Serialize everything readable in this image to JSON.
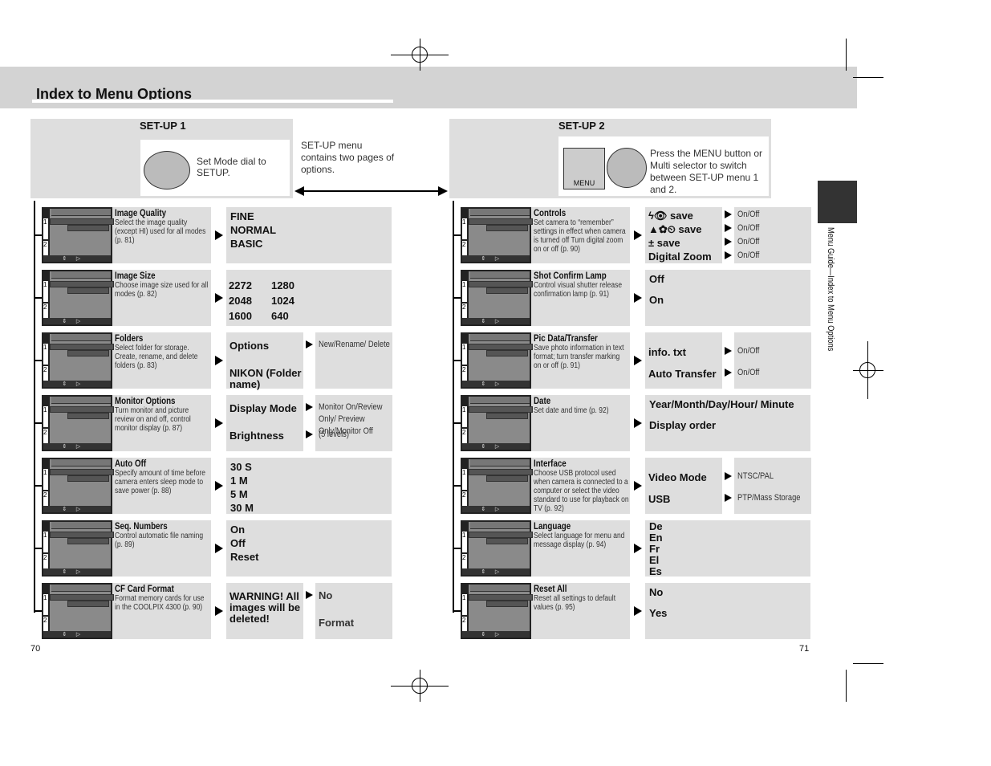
{
  "title": "Index to Menu Options",
  "setup1": {
    "heading": "SET-UP 1",
    "dial_text": "Set Mode dial to SETUP.",
    "note": "SET-UP menu contains two pages of options."
  },
  "setup2": {
    "heading": "SET-UP 2",
    "note": "Press the MENU button or Multi selector to switch between SET-UP menu 1 and 2.",
    "menu_button_label": "MENU"
  },
  "screen": {
    "menu_label": "MENU",
    "page1": "1",
    "page2": "2"
  },
  "left_rows": [
    {
      "name": "Image Quality",
      "desc": "Select the image quality (except HI) used for all modes (p. 81)",
      "options": [
        "FINE",
        "NORMAL",
        "BASIC"
      ]
    },
    {
      "name": "Image Size",
      "desc": "Choose image size used for all modes (p. 82)",
      "grid": [
        [
          "2272",
          "1280"
        ],
        [
          "2048",
          "1024"
        ],
        [
          "1600",
          "640"
        ]
      ]
    },
    {
      "name": "Folders",
      "desc": "Select folder for storage. Create, rename, and delete folders (p. 83)",
      "split": [
        {
          "label": "Options",
          "sub": "New/Rename/ Delete",
          "arrow": true
        },
        {
          "label": "NIKON (Folder name)",
          "sub": "",
          "arrow": false
        }
      ]
    },
    {
      "name": "Monitor Options",
      "desc": "Turn monitor and picture review on and off, control monitor display (p. 87)",
      "split": [
        {
          "label": "Display Mode",
          "sub": "Monitor On/Review Only/ Preview Only/Monitor Off",
          "arrow": true
        },
        {
          "label": "Brightness",
          "sub": "(5 levels)",
          "arrow": true
        }
      ]
    },
    {
      "name": "Auto Off",
      "desc": "Specify amount of time before camera enters sleep mode to save power (p. 88)",
      "options": [
        "30 S",
        "1 M",
        "5 M",
        "30 M"
      ]
    },
    {
      "name": "Seq. Numbers",
      "desc": "Control automatic file naming (p. 89)",
      "options": [
        "On",
        "Off",
        "Reset"
      ]
    },
    {
      "name": "CF Card Format",
      "desc": "Format memory cards for use in the COOLPIX 4300 (p. 90)",
      "split": [
        {
          "label": "WARNING! All images will be deleted!",
          "sub": "No",
          "arrow": true
        },
        {
          "label": "",
          "sub": "Format",
          "arrow": false
        }
      ]
    }
  ],
  "right_rows": [
    {
      "name": "Controls",
      "desc": "Set camera to “remember” settings in effect when camera is turned off Turn digital zoom on or off (p. 90)",
      "split": [
        {
          "label": "ϟ👁  save",
          "sub": "On/Off",
          "arrow": true
        },
        {
          "label": "▲✿⏲  save",
          "sub": "On/Off",
          "arrow": true
        },
        {
          "label": "±  save",
          "sub": "On/Off",
          "arrow": true
        },
        {
          "label": "Digital Zoom",
          "sub": "On/Off",
          "arrow": true
        }
      ]
    },
    {
      "name": "Shot Confirm Lamp",
      "desc": "Control visual shutter release confirmation lamp (p. 91)",
      "options": [
        "Off",
        "On"
      ]
    },
    {
      "name": "Pic Data/Transfer",
      "desc": "Save photo information in text format; turn transfer marking on or off (p. 91)",
      "split": [
        {
          "label": "info. txt",
          "sub": "On/Off",
          "arrow": true
        },
        {
          "label": "Auto Transfer",
          "sub": "On/Off",
          "arrow": true
        }
      ]
    },
    {
      "name": "Date",
      "desc": "Set date and time (p. 92)",
      "options": [
        "Year/Month/Day/Hour/ Minute",
        "Display order"
      ]
    },
    {
      "name": "Interface",
      "desc": "Choose USB protocol used when camera is connected to a computer or select the video standard to use for playback on TV (p. 92)",
      "split": [
        {
          "label": "Video Mode",
          "sub": "NTSC/PAL",
          "arrow": true
        },
        {
          "label": "USB",
          "sub": "PTP/Mass Storage",
          "arrow": true
        }
      ]
    },
    {
      "name": "Language",
      "desc": "Select language for menu and message display (p. 94)",
      "options": [
        "De",
        "En",
        "Fr",
        "El",
        "Es"
      ]
    },
    {
      "name": "Reset All",
      "desc": "Reset all settings to default values (p. 95)",
      "options": [
        "No",
        "Yes"
      ]
    }
  ],
  "side_tab": "Menu Guide—Index to Menu Options",
  "page_left": "70",
  "page_right": "71"
}
